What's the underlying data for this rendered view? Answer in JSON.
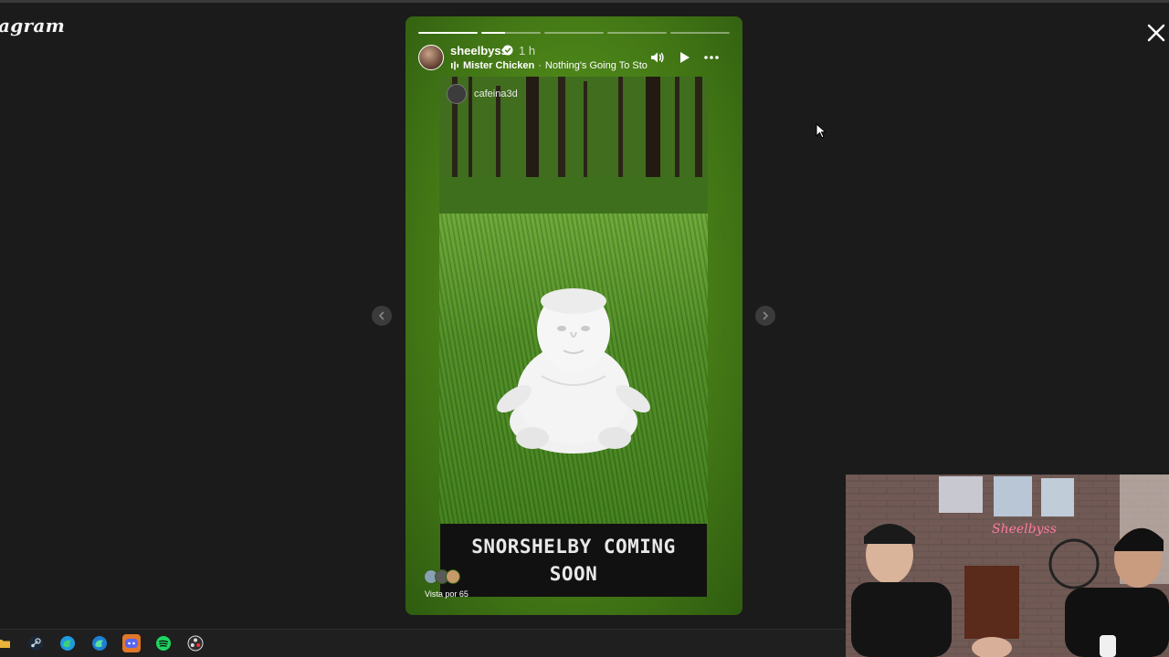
{
  "app": {
    "logo_text": "agram",
    "close_icon": "close-icon"
  },
  "story": {
    "progress_segments": [
      {
        "state": "done"
      },
      {
        "state": "partial",
        "fraction": 0.4
      },
      {
        "state": "todo"
      },
      {
        "state": "todo"
      },
      {
        "state": "todo"
      }
    ],
    "author": {
      "username": "sheelbyss",
      "verified": true,
      "time_ago": "1 h"
    },
    "music": {
      "artist": "Mister Chicken",
      "separator": "·",
      "song": "Nothing's Going To Sto"
    },
    "controls": {
      "mute_icon": "volume-icon",
      "play_icon": "play-icon",
      "more_icon": "more-icon"
    },
    "media": {
      "credit_username": "cafeina3d"
    },
    "caption": {
      "line1": "SNORSHELBY COMING",
      "line2": "SOON"
    },
    "viewers": {
      "label": "Vista por 65"
    }
  },
  "taskbar": {
    "icons": [
      "folder-icon",
      "steam-icon",
      "edge-icon",
      "edge-icon",
      "discord-icon",
      "spotify-icon",
      "obs-icon"
    ],
    "active_index": 4
  },
  "colors": {
    "background": "#1b1b1b",
    "story_green": "#4c8418",
    "caption_bg": "#111111",
    "taskbar_active": "#e0772a"
  }
}
